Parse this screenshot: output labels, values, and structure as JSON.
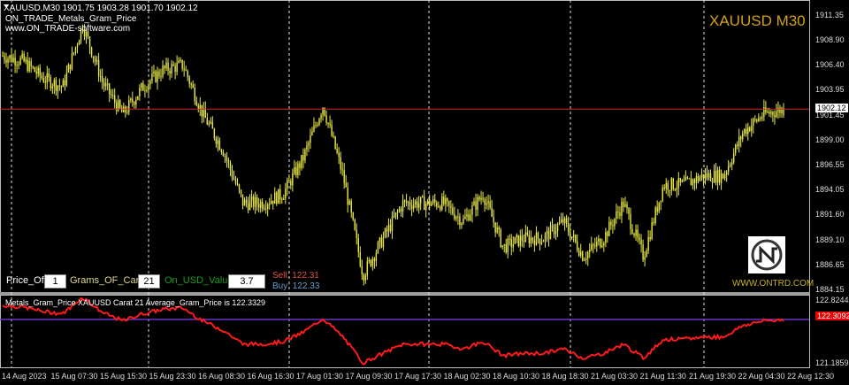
{
  "header": {
    "symbol_line": "XAUUSD,M30  1901.75 1903.28 1901.70 1902.12",
    "indicator_name": "ON_TRADE_Metals_Gram_Price",
    "website": "www.ON_TRADE-software.com",
    "chart_title": "XAUUSD M30"
  },
  "panel": {
    "price_of_label": "Price_Of:",
    "price_of_value": "1",
    "grams_label": "Grams_OF_Carat :",
    "grams_value": "21",
    "usd_label": "On_USD_Value :",
    "usd_value": "3.7",
    "sell_label": "Sell:",
    "sell_value": "122.31",
    "buy_label": "Buy:",
    "buy_value": "122.33"
  },
  "logo": {
    "url": "WWW.ONTRD.COM",
    "text": "N"
  },
  "subwindow": {
    "label": "Metals_Gram_Price  XAUUSD   Carat  21   Average_Gram_Price is   122.3329",
    "current": "122.3092",
    "top": "122.8244",
    "bottom": "121.1859"
  },
  "colors": {
    "candle": "#e8e84a",
    "indicator": "#ff1a1a",
    "level": "#6633cc",
    "price_line": "#c03030",
    "title": "#d4a017"
  },
  "chart_data": {
    "type": "candlestick",
    "symbol": "XAUUSD",
    "timeframe": "M30",
    "current_price": "1902.12",
    "ylim": [
      1884.15,
      1911.35
    ],
    "price_ticks": [
      "1911.35",
      "1908.90",
      "1906.40",
      "1903.95",
      "1901.45",
      "1899.00",
      "1896.55",
      "1894.05",
      "1891.60",
      "1889.10",
      "1886.65",
      "1884.15"
    ],
    "time_ticks": [
      "14 Aug 2023",
      "15 Aug 07:30",
      "15 Aug 15:30",
      "15 Aug 23:30",
      "16 Aug 08:30",
      "16 Aug 16:30",
      "17 Aug 01:30",
      "17 Aug 09:30",
      "17 Aug 17:30",
      "18 Aug 02:30",
      "18 Aug 10:30",
      "18 Aug 18:30",
      "21 Aug 03:30",
      "21 Aug 11:30",
      "21 Aug 19:30",
      "22 Aug 04:30",
      "22 Aug 12:30"
    ],
    "close_path": [
      1907.4,
      1906.9,
      1905.2,
      1904.3,
      1910.5,
      1904.7,
      1901.6,
      1904.3,
      1906.0,
      1906.5,
      1901.6,
      1898.1,
      1892.8,
      1892.8,
      1893.7,
      1897.2,
      1902.5,
      1895.5,
      1885.7,
      1889.3,
      1892.8,
      1892.8,
      1892.8,
      1891.0,
      1893.7,
      1888.4,
      1889.3,
      1889.3,
      1891.0,
      1887.5,
      1889.3,
      1892.8,
      1887.5,
      1894.6,
      1894.6,
      1895.5,
      1895.5,
      1899.9,
      1901.6,
      1902.1
    ],
    "indicator_ylim": [
      121.1859,
      122.8244
    ]
  }
}
